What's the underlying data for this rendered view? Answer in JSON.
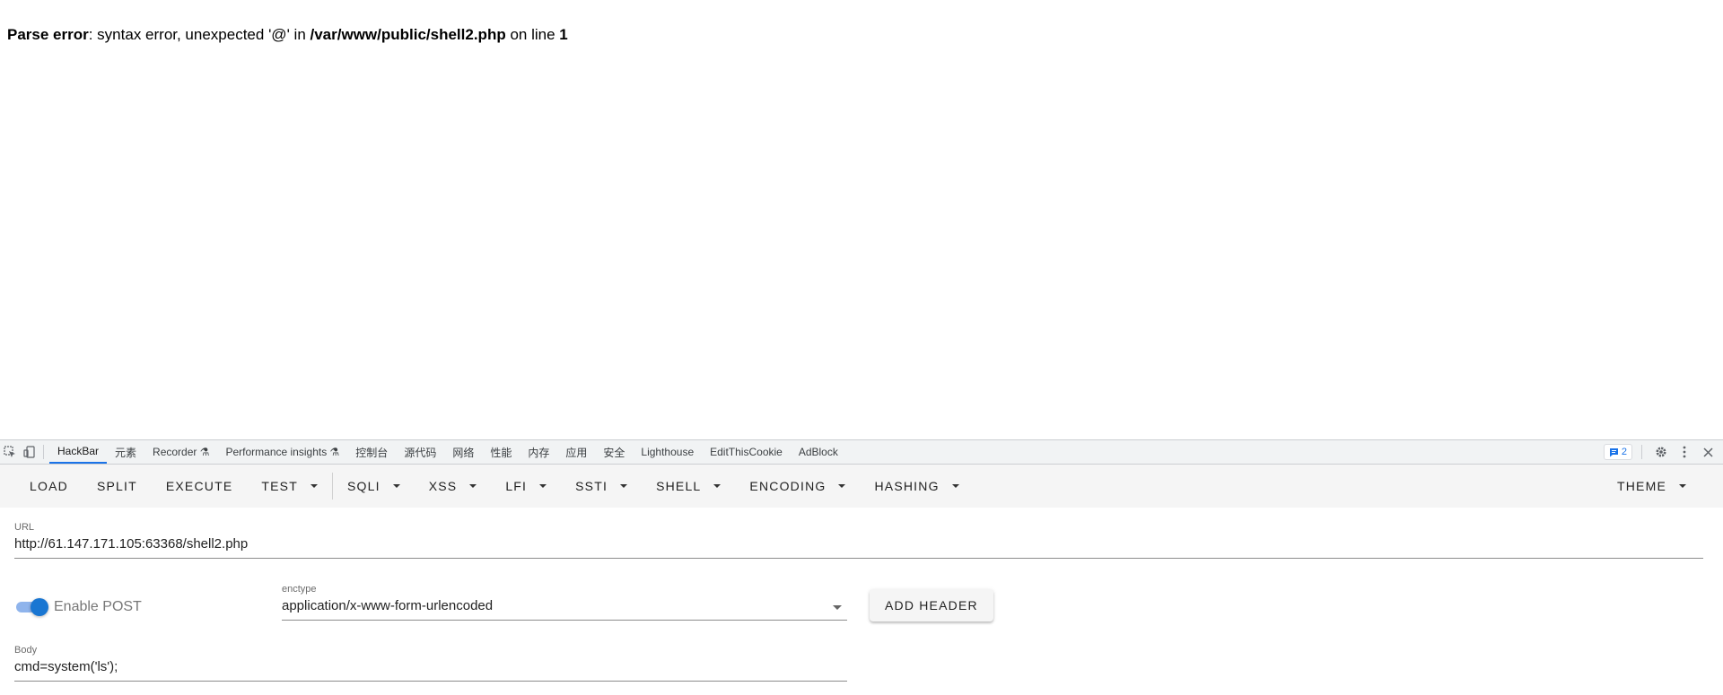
{
  "page": {
    "error_prefix": "Parse error",
    "error_message": ": syntax error, unexpected '@' in ",
    "error_file": "/var/www/public/shell2.php",
    "error_online": " on line ",
    "error_line": "1"
  },
  "devtools": {
    "tabs": [
      {
        "label": "HackBar",
        "active": true
      },
      {
        "label": "元素"
      },
      {
        "label": "Recorder ⚗"
      },
      {
        "label": "Performance insights ⚗"
      },
      {
        "label": "控制台"
      },
      {
        "label": "源代码"
      },
      {
        "label": "网络"
      },
      {
        "label": "性能"
      },
      {
        "label": "内存"
      },
      {
        "label": "应用"
      },
      {
        "label": "安全"
      },
      {
        "label": "Lighthouse"
      },
      {
        "label": "EditThisCookie"
      },
      {
        "label": "AdBlock"
      }
    ],
    "issues_count": "2",
    "icons": [
      "inspect-element-icon",
      "device-toolbar-icon",
      "issues-icon",
      "gear-icon",
      "more-vert-icon",
      "close-icon"
    ]
  },
  "hackbar": {
    "toolbar": {
      "load": "LOAD",
      "split": "SPLIT",
      "execute": "EXECUTE",
      "test": "TEST",
      "sqli": "SQLI",
      "xss": "XSS",
      "lfi": "LFI",
      "ssti": "SSTI",
      "shell": "SHELL",
      "encoding": "ENCODING",
      "hashing": "HASHING",
      "theme": "THEME"
    },
    "url": {
      "label": "URL",
      "value": "http://61.147.171.105:63368/shell2.php"
    },
    "post": {
      "enabled": true,
      "label": "Enable POST"
    },
    "enctype": {
      "label": "enctype",
      "value": "application/x-www-form-urlencoded"
    },
    "add_header": "ADD HEADER",
    "body": {
      "label": "Body",
      "value": "cmd=system('ls');"
    }
  }
}
